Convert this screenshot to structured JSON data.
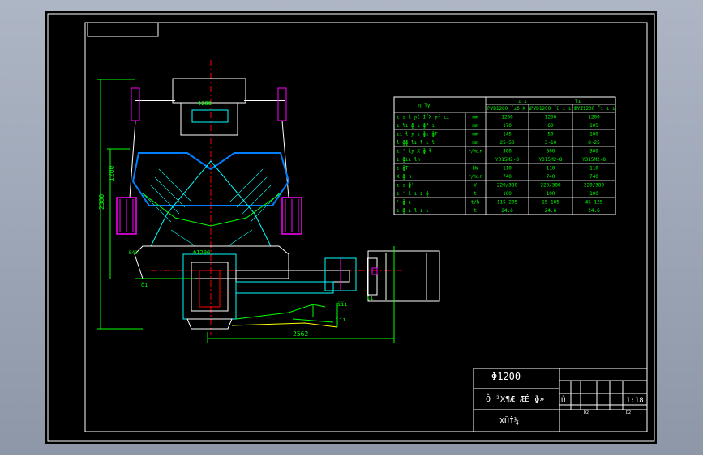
{
  "drawing": {
    "main_dims": {
      "height_total": "2380",
      "height_partial": "1200",
      "width_bottom": "2562",
      "shaft_dia": "Φ280",
      "bowl_dia": "Φ1200",
      "side_label_a": "B42"
    },
    "callouts": [
      "ïı",
      "ïïı",
      "ïïı"
    ],
    "left_mark": "õı"
  },
  "spec_table": {
    "col_headers": [
      "η    Tγ",
      "ı ı",
      "Tı"
    ],
    "sub_headers": [
      "PYB1200 ˚±δ X ı",
      "PYD1200 ˚ü ı ı ı ı",
      "PYZ1200 ˚ı ı ı"
    ],
    "rows": [
      {
        "label": "ı ı ɬ ɲ( Í˚X ɲf ±± ",
        "unit": "mm",
        "v1": "1200",
        "v2": "1200",
        "v3": "1200"
      },
      {
        "label": "ı ɬı ɸ ı ɸf ı",
        "unit": "mm",
        "v1": "170",
        "v2": "60",
        "v3": "105"
      },
      {
        "label": "ıı ɬ ɲ ı ɸı ɸT",
        "unit": "mm",
        "v1": "145",
        "v2": "50",
        "v3": "100"
      },
      {
        "label": "ɬ ɸɸ ɬı ɬ ı ɬ",
        "unit": "mm",
        "v1": "25~50",
        "v2": "3~10",
        "v3": "8~25"
      },
      {
        "label": "ı ' ɬɲ X ɸ ɬ",
        "unit": "r/min",
        "v1": "300",
        "v2": "300",
        "v3": "300"
      },
      {
        "label": "ı ɸıı ɬɲ",
        "unit": "",
        "v1": "Y315M2-8",
        "v2": "Y315M2-8",
        "v3": "Y315M2-8"
      },
      {
        "label": "ı ɸT",
        "unit": "kW",
        "v1": "110",
        "v2": "110",
        "v3": "110"
      },
      {
        "label": "X ɸ ɲ",
        "unit": "r/min",
        "v1": "740",
        "v2": "740",
        "v3": "740"
      },
      {
        "label": "ı ı ɸ'",
        "unit": "V",
        "v1": "220/380",
        "v2": "220/380",
        "v3": "220/380"
      },
      {
        "label": "ı ' ɬ ı ı ɸ",
        "unit": "t",
        "v1": "100",
        "v2": "100",
        "v3": "100"
      },
      {
        "label": "' ɸ ı",
        "unit": "t/h",
        "v1": "115~205",
        "v2": "15~105",
        "v3": "45~125"
      },
      {
        "label": "ı ɸ ı ɬ ı ı",
        "unit": "t",
        "v1": "24.6",
        "v2": "24.6",
        "v3": "24.6"
      }
    ]
  },
  "title_block": {
    "title": "Φ1200",
    "subtitle": "Ô ²X¶Æ ÆÉ ɸ»",
    "drawing_no": "XÜÌ¼",
    "scale": "1:18",
    "mini_labels": [
      "ı",
      "ı",
      "D2",
      "D2",
      "ı",
      "ı",
      "ı",
      "ı",
      "Ù"
    ]
  },
  "colors": {
    "background_frame": "#000000",
    "border": "#ffffff",
    "table_text": "#00ff00",
    "dim_lines": "#00ff00",
    "geometry": "#00ffff",
    "center_lines": "#ff0000",
    "accent_magenta": "#ff00ff",
    "accent_yellow": "#ffff00"
  }
}
